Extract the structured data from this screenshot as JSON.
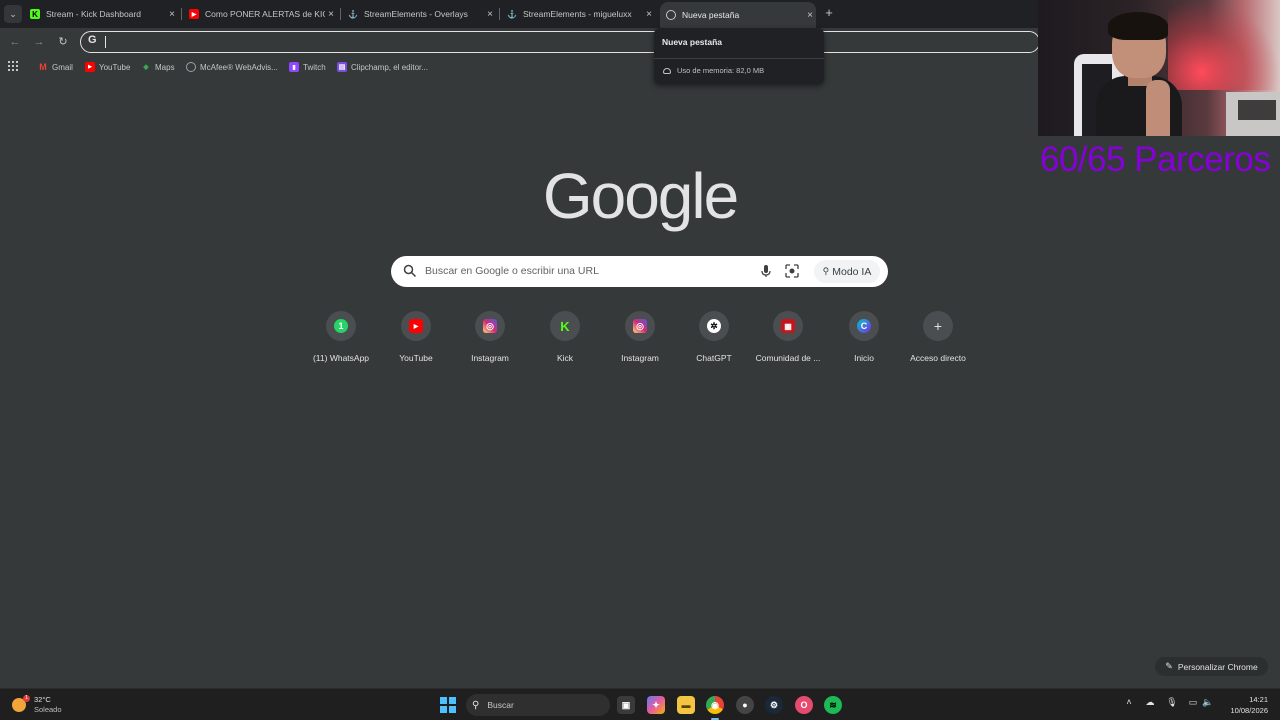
{
  "browser": {
    "tabs": [
      {
        "title": "Stream - Kick Dashboard",
        "icon": "kick-icon",
        "active": false
      },
      {
        "title": "Como PONER ALERTAS de KICK",
        "icon": "youtube-icon",
        "active": false
      },
      {
        "title": "StreamElements - Overlays",
        "icon": "streamelements-icon",
        "active": false
      },
      {
        "title": "StreamElements - migueluxx",
        "icon": "streamelements-icon",
        "active": false
      },
      {
        "title": "Nueva pestaña",
        "icon": "chrome-icon",
        "active": true
      }
    ],
    "close_glyph": "×",
    "new_tab_glyph": "+",
    "omnibox": {
      "value": "",
      "placeholder": ""
    },
    "hover_card": {
      "title": "Nueva pestaña",
      "memory": "Uso de memoria: 82,0 MB"
    },
    "bookmarks": [
      {
        "label": "Gmail",
        "icon": "gmail-icon",
        "color": "#ea4335"
      },
      {
        "label": "YouTube",
        "icon": "youtube-icon",
        "color": "#ff0000"
      },
      {
        "label": "Maps",
        "icon": "maps-icon",
        "color": "#34a853"
      },
      {
        "label": "McAfee® WebAdvis...",
        "icon": "mcafee-icon",
        "color": "#9aa0a6"
      },
      {
        "label": "Twitch",
        "icon": "twitch-icon",
        "color": "#9146ff"
      },
      {
        "label": "Clipchamp, el editor...",
        "icon": "clipchamp-icon",
        "color": "#7b4de0"
      }
    ]
  },
  "overlay": {
    "subs_counter": "60/65 Parceros",
    "counter_color": "#8800d9"
  },
  "ntp": {
    "logo": "Google",
    "search_placeholder": "Buscar en Google o escribir una URL",
    "ai_mode_label": "Modo IA",
    "shortcuts": [
      {
        "label": "(11) WhatsApp",
        "icon": "whatsapp-icon",
        "color": "#25d366",
        "glyph": "1"
      },
      {
        "label": "YouTube",
        "icon": "youtube-icon",
        "color": "#ff0000",
        "glyph": "▶"
      },
      {
        "label": "Instagram",
        "icon": "instagram-icon",
        "color": "#d62976",
        "glyph": "◎"
      },
      {
        "label": "Kick",
        "icon": "kick-icon",
        "color": "#53fc18",
        "glyph": "K"
      },
      {
        "label": "Instagram",
        "icon": "instagram-icon",
        "color": "#d62976",
        "glyph": "◎"
      },
      {
        "label": "ChatGPT",
        "icon": "chatgpt-icon",
        "color": "#ffffff",
        "glyph": "✲"
      },
      {
        "label": "Comunidad de ...",
        "icon": "comunidad-icon",
        "color": "#c4161c",
        "glyph": "▦"
      },
      {
        "label": "Inicio",
        "icon": "canva-icon",
        "color": "#00c4cc",
        "glyph": "C"
      },
      {
        "label": "Acceso directo",
        "icon": "add-shortcut-icon",
        "color": "#4a4e51",
        "glyph": "+"
      }
    ],
    "customize_label": "Personalizar Chrome"
  },
  "taskbar": {
    "weather": {
      "temp": "32°C",
      "condition": "Soleado",
      "badge": "1"
    },
    "search_label": "Buscar",
    "apps": [
      {
        "icon": "task-view-icon",
        "color": "#3a3a3a",
        "glyph": "▣"
      },
      {
        "icon": "copilot-icon",
        "color": "#5b7cf0",
        "glyph": "✦"
      },
      {
        "icon": "file-explorer-icon",
        "color": "#f4c542",
        "glyph": "▬"
      },
      {
        "icon": "chrome-icon",
        "color": "#34a853",
        "glyph": "◉"
      },
      {
        "icon": "obs-icon",
        "color": "#444444",
        "glyph": "●"
      },
      {
        "icon": "steam-icon",
        "color": "#1b2838",
        "glyph": "⚙"
      },
      {
        "icon": "opera-gx-icon",
        "color": "#e64a6f",
        "glyph": "O"
      },
      {
        "icon": "spotify-icon",
        "color": "#1db954",
        "glyph": "≋"
      }
    ],
    "time": "14:21",
    "date": "10/08/2026"
  }
}
